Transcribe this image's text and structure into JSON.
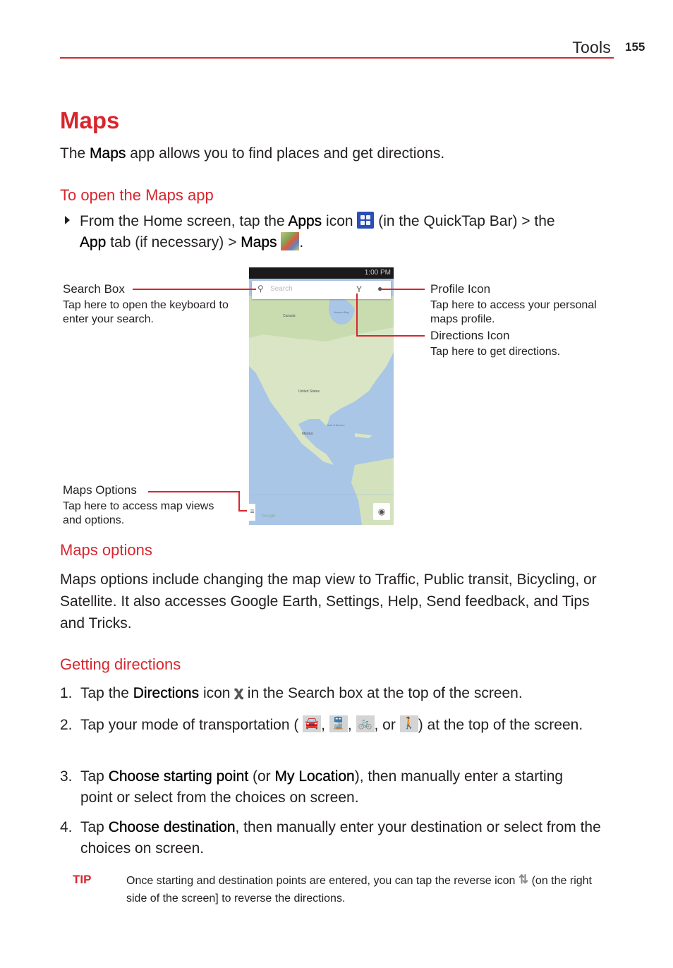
{
  "header": {
    "section": "Tools",
    "page_number": "155"
  },
  "title": "Maps",
  "intro": {
    "pre": "The ",
    "bold": "Maps",
    "post": " app allows you to find places and get directions."
  },
  "open_app": {
    "heading": "To open the Maps app",
    "step": {
      "t1": "From the Home screen, tap the ",
      "b1": "Apps",
      "t2": " icon ",
      "icon1": "apps-grid-icon",
      "t3": " (in the QuickTap Bar) > the",
      "b2": "App",
      "t4": " tab (if necessary) > ",
      "b3": "Maps",
      "icon2": "maps-app-icon",
      "t5": "."
    }
  },
  "screenshot": {
    "status_time": "1:00 PM",
    "search_placeholder": "Search",
    "labels": {
      "canada": "Canada",
      "hudson": "Hudson Bay",
      "us": "United States",
      "gulf": "Gulf of Mexico",
      "mexico": "Mexico",
      "google": "Google"
    },
    "callouts": [
      {
        "title": "Search Box",
        "desc": "Tap here to open the keyboard to enter your search."
      },
      {
        "title": "Profile Icon",
        "desc": "Tap here to access your personal maps profile."
      },
      {
        "title": "Directions Icon",
        "desc": "Tap here to get directions."
      },
      {
        "title": "Maps Options",
        "desc": "Tap here to access map views and options."
      }
    ]
  },
  "maps_options": {
    "heading": "Maps options",
    "text": "Maps options include changing the map view to Traffic, Public transit, Bicycling, or Satellite. It also accesses Google Earth, Settings, Help, Send feedback, and Tips and Tricks."
  },
  "directions": {
    "heading": "Getting directions",
    "steps": [
      {
        "num": "1.",
        "t1": "Tap the ",
        "b1": "Directions",
        "t2": " icon ",
        "icon": "directions-icon",
        "t3": " in the Search box at the top of the screen."
      },
      {
        "num": "2.",
        "t1": "Tap your mode of transportation ( ",
        "icons": [
          "car-icon",
          "transit-icon",
          "bicycle-icon",
          "walking-icon"
        ],
        "sep": ", ",
        "or": ", or ",
        "t2": ") at the top of the screen."
      },
      {
        "num": "3.",
        "t1": "Tap ",
        "b1": "Choose starting point",
        "t2": " (or ",
        "b2": "My Location",
        "t3": "), then manually enter a starting point or select from the choices on screen."
      },
      {
        "num": "4.",
        "t1": "Tap ",
        "b1": "Choose destination",
        "t2": ", then manually enter your destination or select from the choices on screen."
      }
    ]
  },
  "tip": {
    "label": "TIP",
    "t1": "Once starting and destination points are entered, you can tap the reverse icon ",
    "icon": "reverse-arrows-icon",
    "t2": " (on the right side of the screen] to reverse the directions."
  },
  "colors": {
    "accent_red": "#d7262e",
    "text": "#231f20"
  }
}
